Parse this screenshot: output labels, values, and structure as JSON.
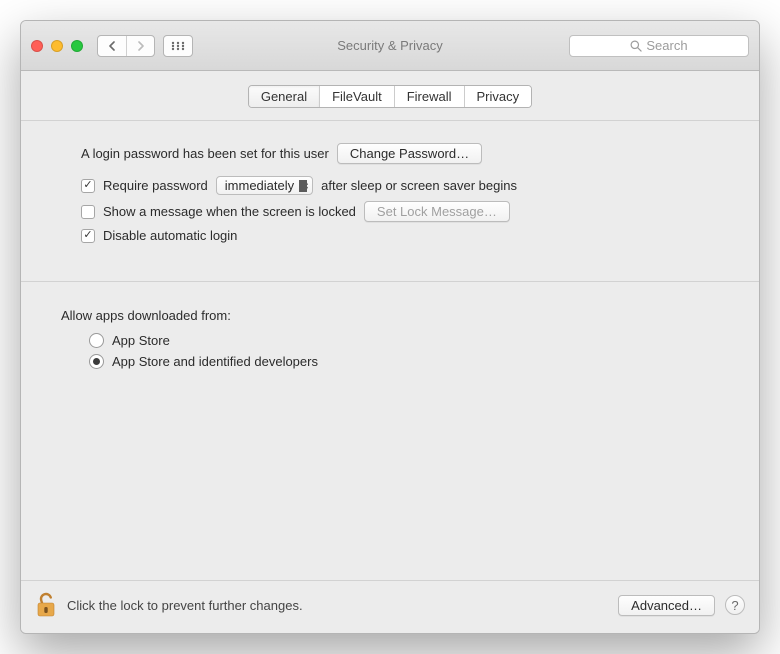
{
  "window": {
    "title": "Security & Privacy",
    "search_placeholder": "Search"
  },
  "tabs": [
    {
      "label": "General",
      "active": true
    },
    {
      "label": "FileVault",
      "active": false
    },
    {
      "label": "Firewall",
      "active": false
    },
    {
      "label": "Privacy",
      "active": false
    }
  ],
  "general": {
    "login_password_text": "A login password has been set for this user",
    "change_password_btn": "Change Password…",
    "require_pw_label": "Require password",
    "require_pw_checked": true,
    "require_pw_delay": "immediately",
    "require_pw_suffix": "after sleep or screen saver begins",
    "show_message_label": "Show a message when the screen is locked",
    "show_message_checked": false,
    "set_lock_message_btn": "Set Lock Message…",
    "disable_auto_login_label": "Disable automatic login",
    "disable_auto_login_checked": true
  },
  "gatekeeper": {
    "section_label": "Allow apps downloaded from:",
    "options": [
      {
        "label": "App Store",
        "selected": false
      },
      {
        "label": "App Store and identified developers",
        "selected": true
      }
    ]
  },
  "footer": {
    "hint": "Click the lock to prevent further changes.",
    "advanced_btn": "Advanced…",
    "help_label": "?"
  }
}
